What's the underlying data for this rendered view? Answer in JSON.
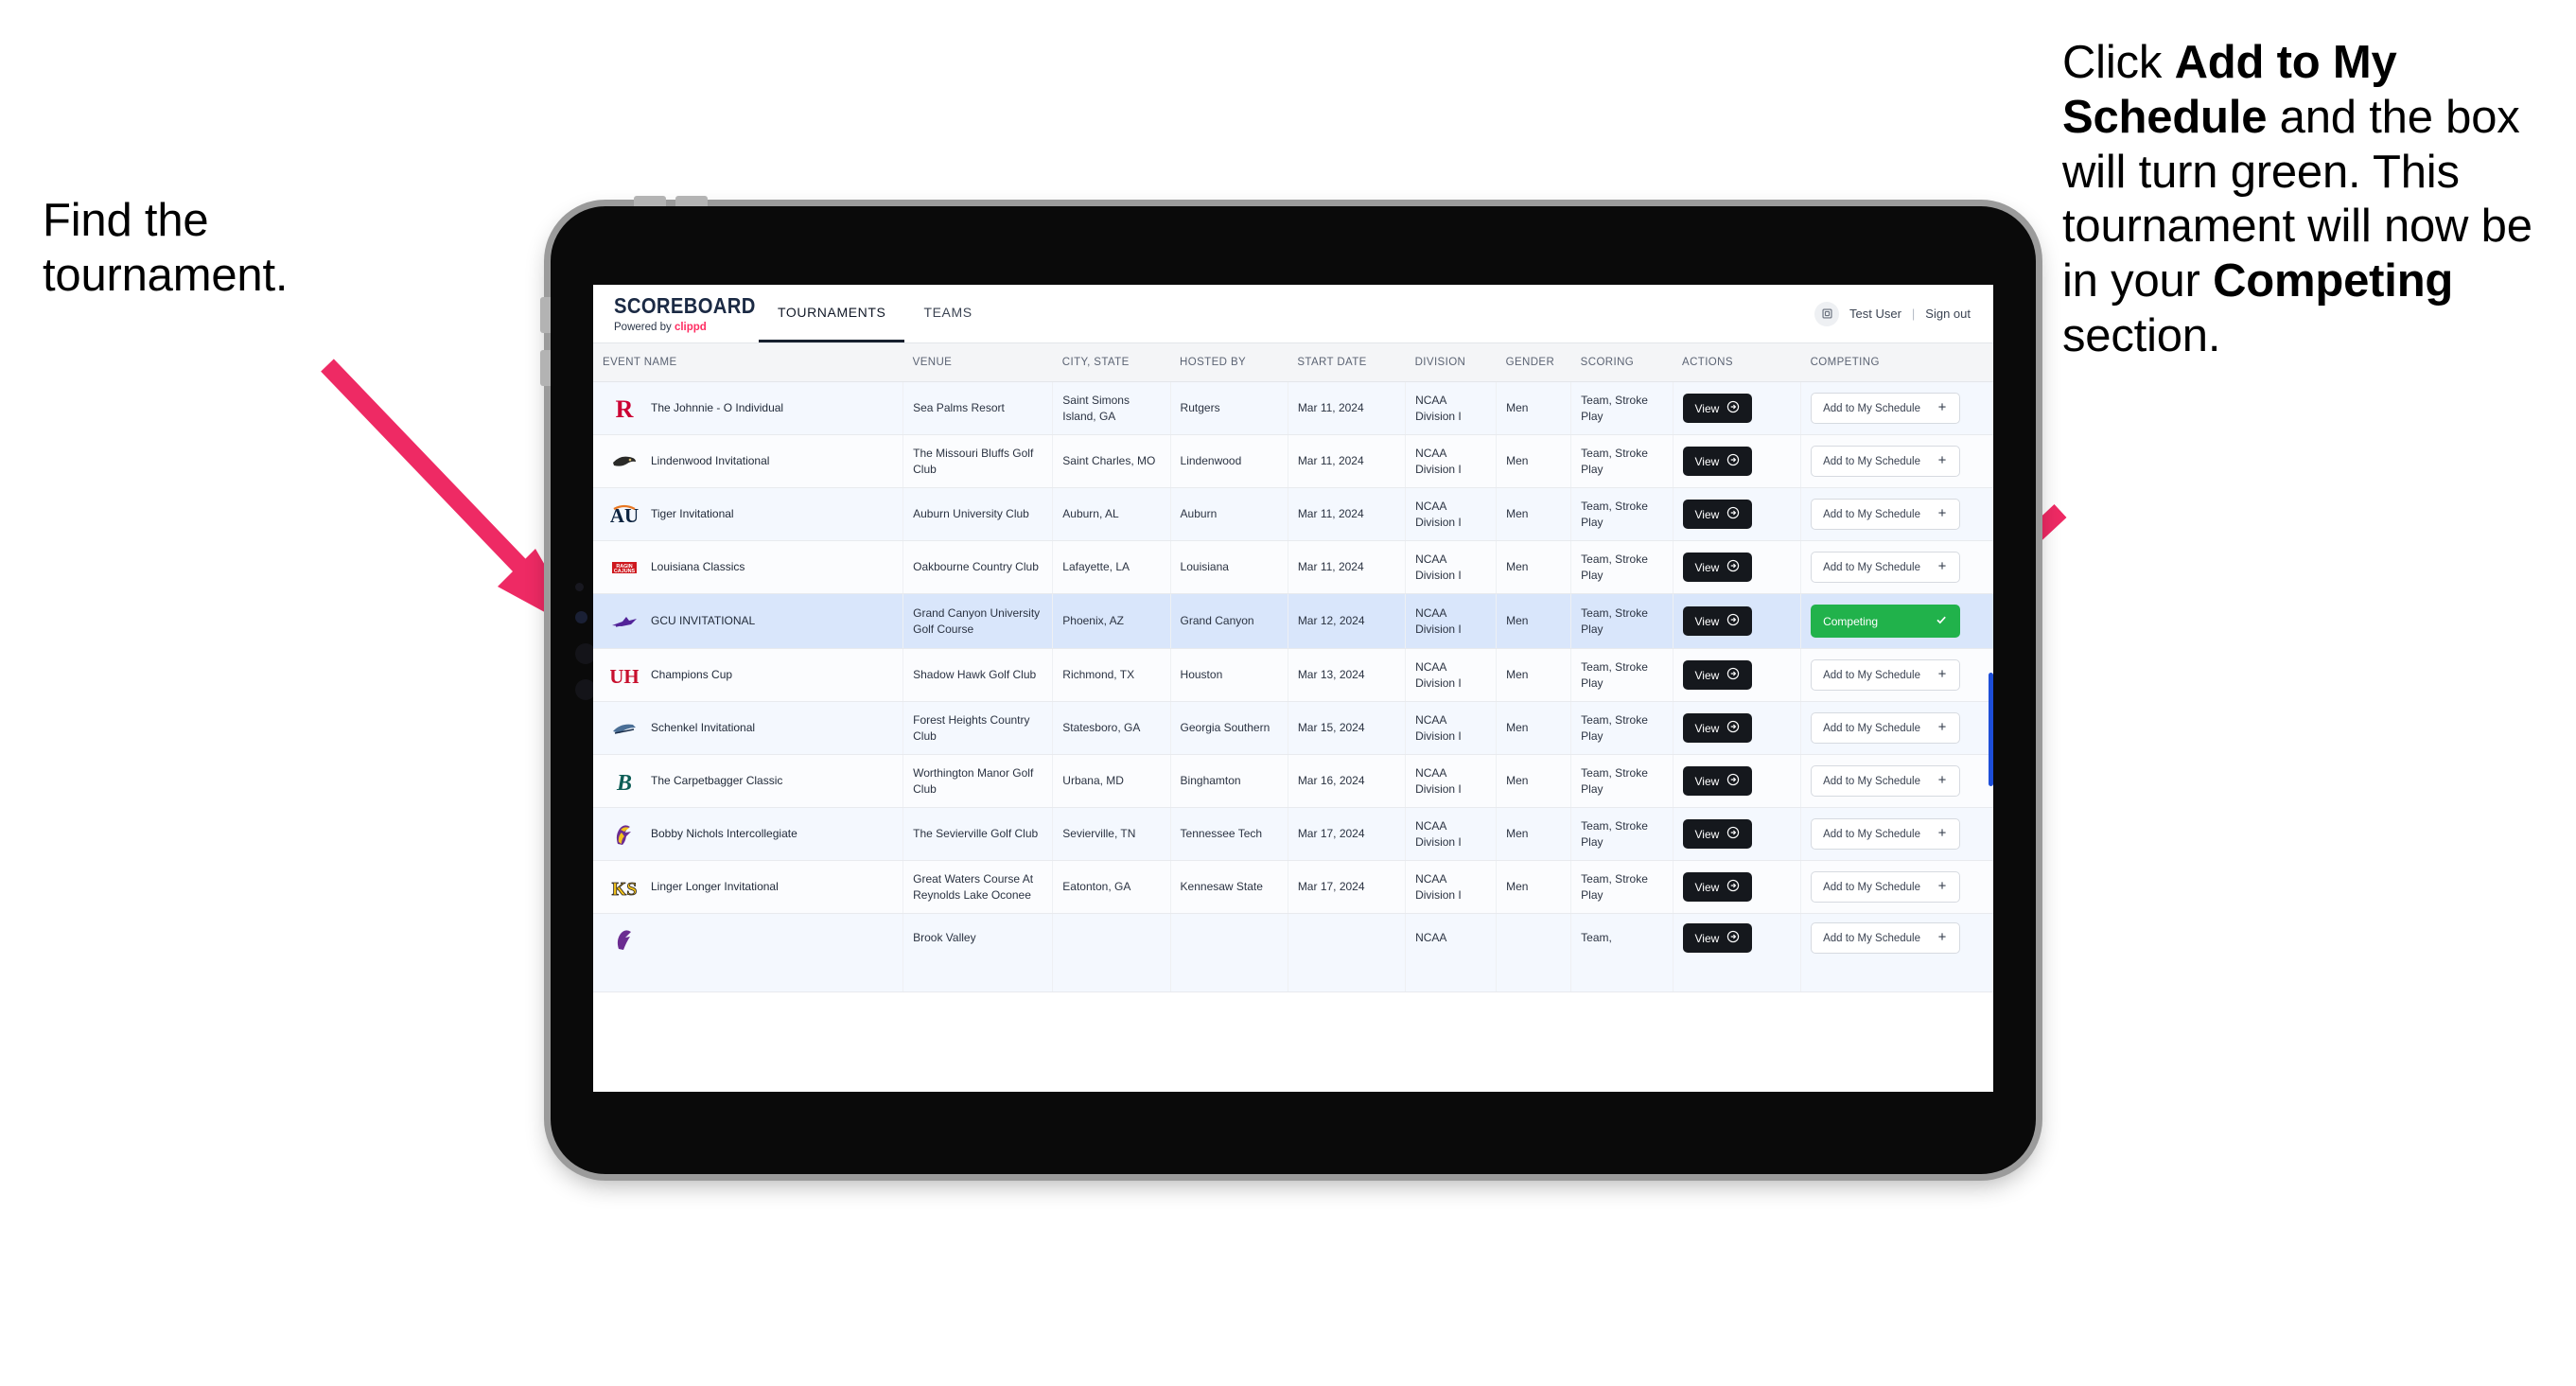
{
  "annotations": {
    "left": {
      "line1": "Find the",
      "line2": "tournament."
    },
    "right": {
      "part1": "Click ",
      "bold1": "Add to My Schedule",
      "part2": " and the box will turn green. This tournament will now be in your ",
      "bold2": "Competing",
      "part3": " section."
    },
    "arrow_color": "#ee2a64"
  },
  "app": {
    "brand": {
      "title": "SCOREBOARD",
      "powered_prefix": "Powered by ",
      "powered_name": "clippd"
    },
    "nav": [
      {
        "label": "TOURNAMENTS",
        "active": true
      },
      {
        "label": "TEAMS",
        "active": false
      }
    ],
    "user": {
      "avatar_icon": "user-avatar-icon",
      "name": "Test User",
      "separator": "|",
      "signout": "Sign out"
    }
  },
  "table": {
    "columns": [
      "EVENT NAME",
      "VENUE",
      "CITY, STATE",
      "HOSTED BY",
      "START DATE",
      "DIVISION",
      "GENDER",
      "SCORING",
      "ACTIONS",
      "COMPETING"
    ],
    "action_label": "View",
    "action_icon": "arrow-right-circle-icon",
    "add_label": "Add to My Schedule",
    "add_icon": "plus-icon",
    "competing_label": "Competing",
    "competing_icon": "check-icon",
    "competing_color": "#21b24b",
    "rows": [
      {
        "event": "The Johnnie - O Individual",
        "venue": "Sea Palms Resort",
        "city": "Saint Simons Island, GA",
        "host": "Rutgers",
        "date": "Mar 11, 2024",
        "division": "NCAA Division I",
        "gender": "Men",
        "scoring": "Team, Stroke Play",
        "competing": false,
        "logo": "rutgers-logo"
      },
      {
        "event": "Lindenwood Invitational",
        "venue": "The Missouri Bluffs Golf Club",
        "city": "Saint Charles, MO",
        "host": "Lindenwood",
        "date": "Mar 11, 2024",
        "division": "NCAA Division I",
        "gender": "Men",
        "scoring": "Team, Stroke Play",
        "competing": false,
        "logo": "lindenwood-logo"
      },
      {
        "event": "Tiger Invitational",
        "venue": "Auburn University Club",
        "city": "Auburn, AL",
        "host": "Auburn",
        "date": "Mar 11, 2024",
        "division": "NCAA Division I",
        "gender": "Men",
        "scoring": "Team, Stroke Play",
        "competing": false,
        "logo": "auburn-logo"
      },
      {
        "event": "Louisiana Classics",
        "venue": "Oakbourne Country Club",
        "city": "Lafayette, LA",
        "host": "Louisiana",
        "date": "Mar 11, 2024",
        "division": "NCAA Division I",
        "gender": "Men",
        "scoring": "Team, Stroke Play",
        "competing": false,
        "logo": "louisiana-logo"
      },
      {
        "event": "GCU INVITATIONAL",
        "venue": "Grand Canyon University Golf Course",
        "city": "Phoenix, AZ",
        "host": "Grand Canyon",
        "date": "Mar 12, 2024",
        "division": "NCAA Division I",
        "gender": "Men",
        "scoring": "Team, Stroke Play",
        "competing": true,
        "logo": "grand-canyon-logo"
      },
      {
        "event": "Champions Cup",
        "venue": "Shadow Hawk Golf Club",
        "city": "Richmond, TX",
        "host": "Houston",
        "date": "Mar 13, 2024",
        "division": "NCAA Division I",
        "gender": "Men",
        "scoring": "Team, Stroke Play",
        "competing": false,
        "logo": "houston-logo"
      },
      {
        "event": "Schenkel Invitational",
        "venue": "Forest Heights Country Club",
        "city": "Statesboro, GA",
        "host": "Georgia Southern",
        "date": "Mar 15, 2024",
        "division": "NCAA Division I",
        "gender": "Men",
        "scoring": "Team, Stroke Play",
        "competing": false,
        "logo": "georgia-southern-logo"
      },
      {
        "event": "The Carpetbagger Classic",
        "venue": "Worthington Manor Golf Club",
        "city": "Urbana, MD",
        "host": "Binghamton",
        "date": "Mar 16, 2024",
        "division": "NCAA Division I",
        "gender": "Men",
        "scoring": "Team, Stroke Play",
        "competing": false,
        "logo": "binghamton-logo"
      },
      {
        "event": "Bobby Nichols Intercollegiate",
        "venue": "The Sevierville Golf Club",
        "city": "Sevierville, TN",
        "host": "Tennessee Tech",
        "date": "Mar 17, 2024",
        "division": "NCAA Division I",
        "gender": "Men",
        "scoring": "Team, Stroke Play",
        "competing": false,
        "logo": "tennessee-tech-logo"
      },
      {
        "event": "Linger Longer Invitational",
        "venue": "Great Waters Course At Reynolds Lake Oconee",
        "city": "Eatonton, GA",
        "host": "Kennesaw State",
        "date": "Mar 17, 2024",
        "division": "NCAA Division I",
        "gender": "Men",
        "scoring": "Team, Stroke Play",
        "competing": false,
        "logo": "kennesaw-state-logo"
      },
      {
        "event": "",
        "venue": "Brook Valley",
        "city": "",
        "host": "",
        "date": "",
        "division": "NCAA",
        "gender": "",
        "scoring": "Team,",
        "competing": false,
        "logo": "partial-logo",
        "cut": true
      }
    ]
  }
}
